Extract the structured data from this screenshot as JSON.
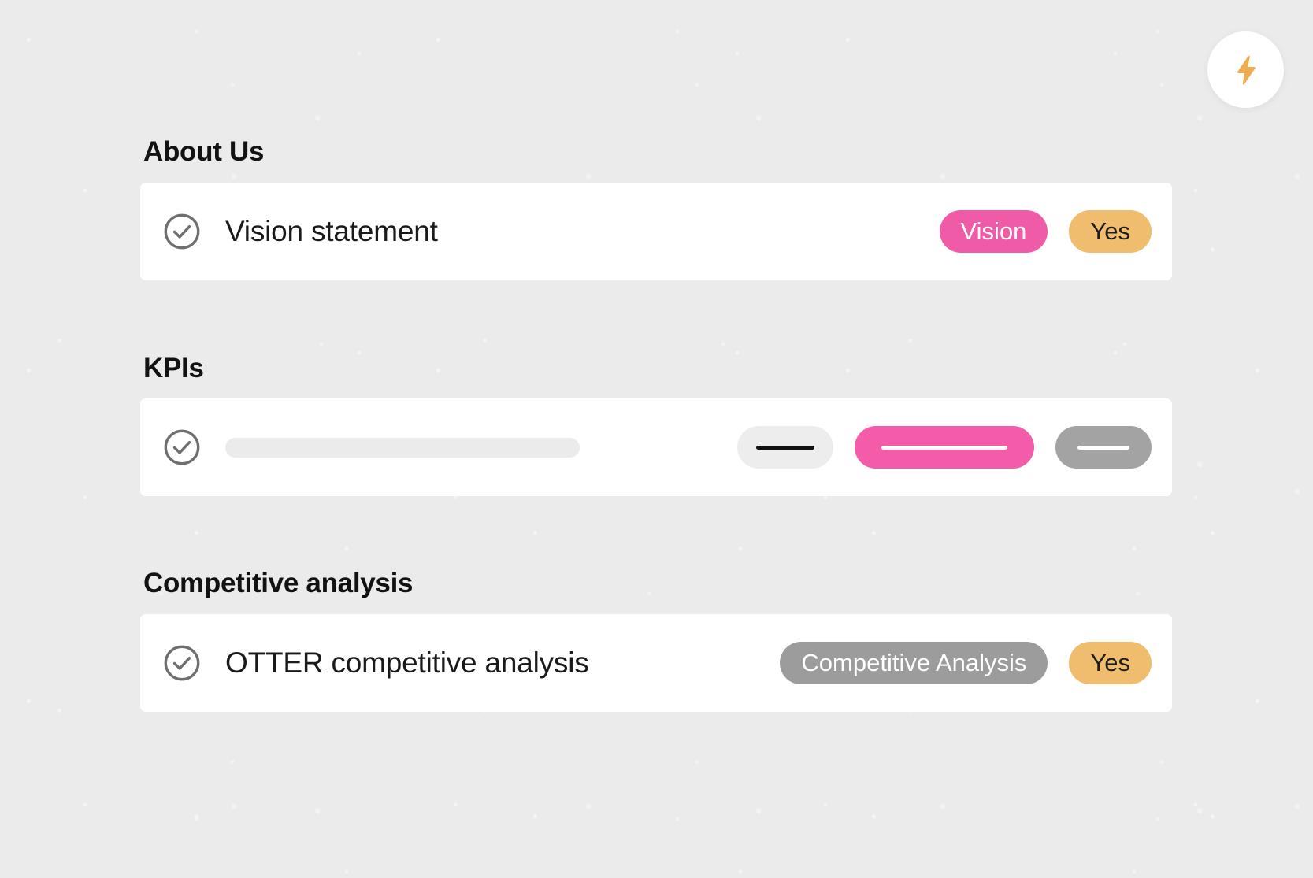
{
  "toolbar": {
    "spark_button": {
      "icon": "lightning-bolt-icon",
      "icon_color": "#eeab4f",
      "background": "#ffffff"
    }
  },
  "colors": {
    "page_background": "#ebebeb",
    "card_background": "#ffffff",
    "accent_pink": "#f05ba8",
    "accent_amber": "#f0bd6e",
    "accent_gray": "#9c9c9c",
    "heading_text": "#121212"
  },
  "sections": [
    {
      "heading": "About Us",
      "state": "loaded",
      "row": {
        "status_icon": "circle-check-icon",
        "title": "Vision statement",
        "badges": [
          {
            "label": "Vision",
            "style": "pink"
          },
          {
            "label": "Yes",
            "style": "amber"
          }
        ]
      }
    },
    {
      "heading": "KPIs",
      "state": "loading",
      "row": {
        "status_icon": "circle-check-icon",
        "title_placeholder": "",
        "badge_placeholders": [
          {
            "style": "light"
          },
          {
            "style": "pink"
          },
          {
            "style": "gray"
          }
        ]
      }
    },
    {
      "heading": "Competitive analysis",
      "state": "loaded",
      "row": {
        "status_icon": "circle-check-icon",
        "title": "OTTER competitive analysis",
        "badges": [
          {
            "label": "Competitive Analysis",
            "style": "gray"
          },
          {
            "label": "Yes",
            "style": "amber"
          }
        ]
      }
    }
  ]
}
